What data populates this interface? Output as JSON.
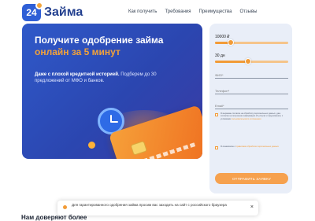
{
  "brand": {
    "logo_mark": "24",
    "name": "Займа"
  },
  "nav": {
    "items": [
      {
        "label": "Как получить"
      },
      {
        "label": "Требования"
      },
      {
        "label": "Преимущества"
      },
      {
        "label": "Отзывы"
      }
    ]
  },
  "hero": {
    "title_part1": "Получите одобрение займа ",
    "title_accent": "онлайн за 5 минут",
    "subtitle_bold": "Даже с плохой кредитной историей.",
    "subtitle_rest": " Подберем до 30 предложений от МФО и банков."
  },
  "form": {
    "amount": {
      "value": "10000 ₽",
      "fill_fraction": 0.22
    },
    "term": {
      "value": "30 дн",
      "fill_fraction": 0.45
    },
    "fields": [
      {
        "placeholder": "ФИО*"
      },
      {
        "placeholder": "Телефон*"
      },
      {
        "placeholder": "Email*"
      }
    ],
    "consent1_text": "Я выражаю согласие на обработку персональных данных, даю согласие на получение информации об услугах и предложения, с условиями",
    "consent1_link": "пользовательского соглашения",
    "consent2_text": "Я ознакомлен с",
    "consent2_link": "правилами обработки персональных данных",
    "submit_label": "ОТПРАВИТЬ ЗАЯВКУ"
  },
  "cookie": {
    "text": "Для гарантированного одобрения займа просим вас заходить на сайт с российского браузера",
    "close_label": "×"
  },
  "section_heading": "Нам доверяют более",
  "colors": {
    "primary": "#2f59c9",
    "accent": "#f29b37",
    "panel": "#e9eef8"
  }
}
